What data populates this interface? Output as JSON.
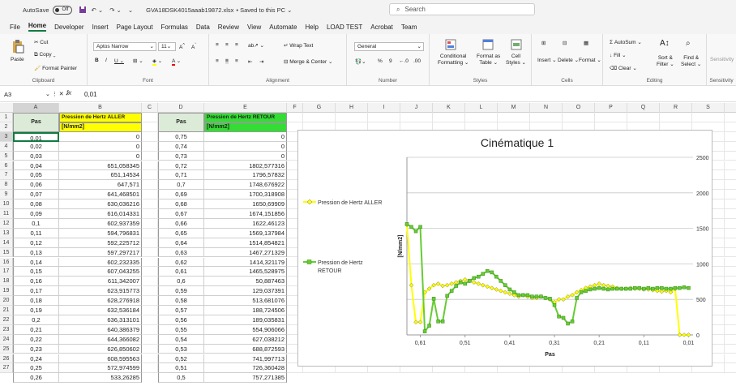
{
  "titlebar": {
    "autosave_label": "AutoSave",
    "autosave_state": "Off",
    "filename": "GVA18DSK4015aaab19872.xlsx",
    "saved_status": "• Saved to this PC ⌄",
    "search_placeholder": "Search"
  },
  "menu": [
    "File",
    "Home",
    "Developer",
    "Insert",
    "Page Layout",
    "Formulas",
    "Data",
    "Review",
    "View",
    "Automate",
    "Help",
    "LOAD TEST",
    "Acrobat",
    "Team"
  ],
  "ribbon": {
    "clipboard": {
      "paste": "Paste",
      "cut": "Cut",
      "copy": "Copy ⌄",
      "format_painter": "Format Painter",
      "label": "Clipboard"
    },
    "font": {
      "name": "Aptos Narrow",
      "size": "11",
      "label": "Font"
    },
    "alignment": {
      "wrap": "Wrap Text",
      "merge": "Merge & Center ⌄",
      "label": "Alignment"
    },
    "number": {
      "format": "General",
      "label": "Number"
    },
    "styles": {
      "conditional": "Conditional",
      "conditional2": "Formatting ⌄",
      "format_as": "Format as",
      "format_as2": "Table ⌄",
      "cell_styles": "Cell",
      "cell_styles2": "Styles ⌄",
      "label": "Styles"
    },
    "cells": {
      "insert": "Insert",
      "delete": "Delete",
      "format": "Format",
      "label": "Cells"
    },
    "editing": {
      "autosum": "AutoSum ⌄",
      "fill": "Fill ⌄",
      "clear": "Clear ⌄",
      "sort": "Sort &",
      "sort2": "Filter ⌄",
      "find": "Find &",
      "find2": "Select ⌄",
      "label": "Editing"
    },
    "sensitivity": {
      "label": "Sensitivity",
      "btn": "Sensitivity"
    }
  },
  "formula_bar": {
    "cell_ref": "A3",
    "fx": "fx",
    "value": "0,01"
  },
  "columns": [
    "A",
    "B",
    "C",
    "D",
    "E",
    "F",
    "G",
    "H",
    "I",
    "J",
    "K",
    "L",
    "M",
    "N",
    "O",
    "P",
    "Q",
    "R",
    "S",
    "T"
  ],
  "rows": [
    "1",
    "2",
    "3",
    "4",
    "5",
    "6",
    "7",
    "8",
    "9",
    "10",
    "11",
    "12",
    "13",
    "14",
    "15",
    "16",
    "17",
    "18",
    "19",
    "20",
    "21",
    "22",
    "23",
    "24",
    "25",
    "26",
    "27"
  ],
  "table_left": {
    "h_pas": "Pas",
    "h_pression": "Pression de Hertz ALLER",
    "h_unit": "[N/mm2]",
    "pas": [
      "0,01",
      "0,02",
      "0,03",
      "0,04",
      "0,05",
      "0,06",
      "0,07",
      "0,08",
      "0,09",
      "0,1",
      "0,11",
      "0,12",
      "0,13",
      "0,14",
      "0,15",
      "0,16",
      "0,17",
      "0,18",
      "0,19",
      "0,2",
      "0,21",
      "0,22",
      "0,23",
      "0,24",
      "0,25",
      "0,26"
    ],
    "values": [
      "0",
      "0",
      "0",
      "651,058345",
      "651,14534",
      "647,571",
      "641,468501",
      "630,036216",
      "616,014331",
      "602,937359",
      "594,796831",
      "592,225712",
      "597,297217",
      "602,232335",
      "607,043255",
      "611,342007",
      "623,915773",
      "628,276918",
      "632,536184",
      "636,313101",
      "640,386379",
      "644,366082",
      "626,850602",
      "608,595563",
      "572,974599",
      "533,26285"
    ]
  },
  "table_right": {
    "h_pas": "Pas",
    "h_pression": "Pression de Hertz RETOUR",
    "h_unit": "[N/mm2]",
    "pas": [
      "0,75",
      "0,74",
      "0,73",
      "0,72",
      "0,71",
      "0,7",
      "0,69",
      "0,68",
      "0,67",
      "0,66",
      "0,65",
      "0,64",
      "0,63",
      "0,62",
      "0,61",
      "0,6",
      "0,59",
      "0,58",
      "0,57",
      "0,56",
      "0,55",
      "0,54",
      "0,53",
      "0,52",
      "0,51",
      "0,5"
    ],
    "values": [
      "0",
      "0",
      "0",
      "1802,577316",
      "1796,57832",
      "1748,676922",
      "1700,318908",
      "1650,69909",
      "1674,151856",
      "1622,46123",
      "1569,137984",
      "1514,854821",
      "1467,271329",
      "1414,321179",
      "1465,528975",
      "50,887463",
      "129,037391",
      "513,681076",
      "188,724506",
      "189,035831",
      "554,906066",
      "627,038212",
      "688,872593",
      "741,997713",
      "726,360428",
      "757,271385"
    ]
  },
  "chart_data": {
    "type": "line",
    "title": "Cinématique 1",
    "xlabel": "Pas",
    "ylabel": "[N/mm2]",
    "ylim": [
      0,
      2500
    ],
    "yticks": [
      "0",
      "500",
      "1000",
      "1500",
      "2000",
      "2500"
    ],
    "xticks": [
      "0,61",
      "0,51",
      "0,41",
      "0,31",
      "0,21",
      "0,11",
      "0,01"
    ],
    "xlim": [
      0.64,
      0.0
    ],
    "legend_position": "left",
    "grid": true,
    "series": [
      {
        "name": "Pression de Hertz ALLER",
        "color": "#ffff00",
        "marker": "diamond",
        "x": [
          0.64,
          0.63,
          0.62,
          0.61,
          0.6,
          0.59,
          0.58,
          0.57,
          0.56,
          0.55,
          0.54,
          0.53,
          0.52,
          0.51,
          0.5,
          0.49,
          0.48,
          0.47,
          0.46,
          0.45,
          0.44,
          0.43,
          0.42,
          0.41,
          0.4,
          0.39,
          0.38,
          0.37,
          0.36,
          0.35,
          0.34,
          0.33,
          0.32,
          0.31,
          0.3,
          0.29,
          0.28,
          0.27,
          0.26,
          0.25,
          0.24,
          0.23,
          0.22,
          0.21,
          0.2,
          0.19,
          0.18,
          0.17,
          0.16,
          0.15,
          0.14,
          0.13,
          0.12,
          0.11,
          0.1,
          0.09,
          0.08,
          0.07,
          0.06,
          0.05,
          0.04,
          0.03,
          0.02,
          0.01
        ],
        "y": [
          1550,
          700,
          180,
          180,
          600,
          650,
          700,
          720,
          690,
          700,
          720,
          740,
          760,
          780,
          760,
          740,
          720,
          700,
          680,
          660,
          640,
          620,
          600,
          580,
          560,
          540,
          560,
          540,
          520,
          520,
          540,
          520,
          500,
          460,
          500,
          500,
          540,
          560,
          600,
          630,
          660,
          680,
          700,
          720,
          700,
          690,
          680,
          660,
          650,
          650,
          660,
          650,
          650,
          640,
          640,
          630,
          620,
          610,
          620,
          600,
          650,
          0,
          0,
          0
        ]
      },
      {
        "name": "Pression de Hertz RETOUR",
        "color": "#66cc33",
        "marker": "square",
        "x": [
          0.64,
          0.63,
          0.62,
          0.61,
          0.6,
          0.59,
          0.58,
          0.57,
          0.56,
          0.55,
          0.54,
          0.53,
          0.52,
          0.51,
          0.5,
          0.49,
          0.48,
          0.47,
          0.46,
          0.45,
          0.44,
          0.43,
          0.42,
          0.41,
          0.4,
          0.39,
          0.38,
          0.37,
          0.36,
          0.35,
          0.34,
          0.33,
          0.32,
          0.31,
          0.3,
          0.29,
          0.28,
          0.27,
          0.26,
          0.25,
          0.24,
          0.23,
          0.22,
          0.21,
          0.2,
          0.19,
          0.18,
          0.17,
          0.16,
          0.15,
          0.14,
          0.13,
          0.12,
          0.11,
          0.1,
          0.09,
          0.08,
          0.07,
          0.06,
          0.05,
          0.04,
          0.03,
          0.02,
          0.01
        ],
        "y": [
          1560,
          1520,
          1460,
          1520,
          50,
          130,
          510,
          190,
          190,
          550,
          620,
          690,
          740,
          720,
          760,
          800,
          820,
          860,
          900,
          880,
          820,
          760,
          700,
          640,
          600,
          560,
          560,
          560,
          540,
          540,
          540,
          520,
          510,
          420,
          260,
          240,
          160,
          190,
          520,
          600,
          620,
          640,
          650,
          660,
          650,
          640,
          650,
          650,
          650,
          650,
          650,
          660,
          660,
          650,
          660,
          650,
          660,
          660,
          650,
          650,
          660,
          660,
          670,
          660
        ]
      }
    ]
  }
}
